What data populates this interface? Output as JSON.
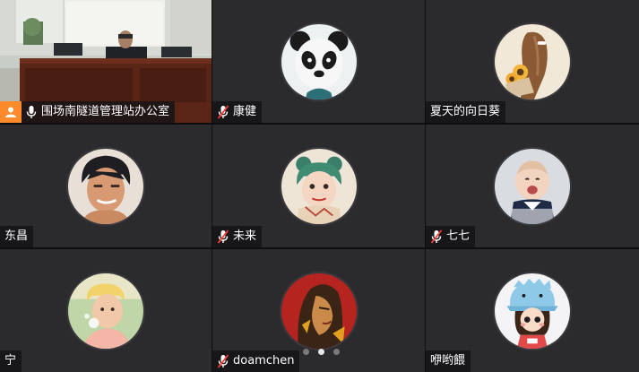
{
  "participants": [
    {
      "name": "围场南隧道管理站办公室",
      "mic": "on",
      "host": true,
      "video": true
    },
    {
      "name": "康健",
      "mic": "muted",
      "avatar": "panda-avatar"
    },
    {
      "name": "夏天的向日葵",
      "mic": "none",
      "avatar": "sunflower-girl-avatar"
    },
    {
      "name": "东昌",
      "mic": "none",
      "avatar": "anime-man-avatar"
    },
    {
      "name": "未来",
      "mic": "muted",
      "avatar": "anime-girl-avatar"
    },
    {
      "name": "七七",
      "mic": "muted",
      "avatar": "baby-avatar"
    },
    {
      "name": "宁",
      "mic": "none",
      "avatar": "child-bubble-avatar"
    },
    {
      "name": "doamchen",
      "mic": "muted",
      "avatar": "red-art-avatar"
    },
    {
      "name": "咿哟餵",
      "mic": "none",
      "avatar": "cartoon-girl-hat-avatar"
    }
  ],
  "pager": {
    "pages": 3,
    "current": 2
  },
  "colors": {
    "active_border": "#3fbf5f",
    "host_badge": "#ff8a2b",
    "mic_muted": "#ff3b30"
  }
}
